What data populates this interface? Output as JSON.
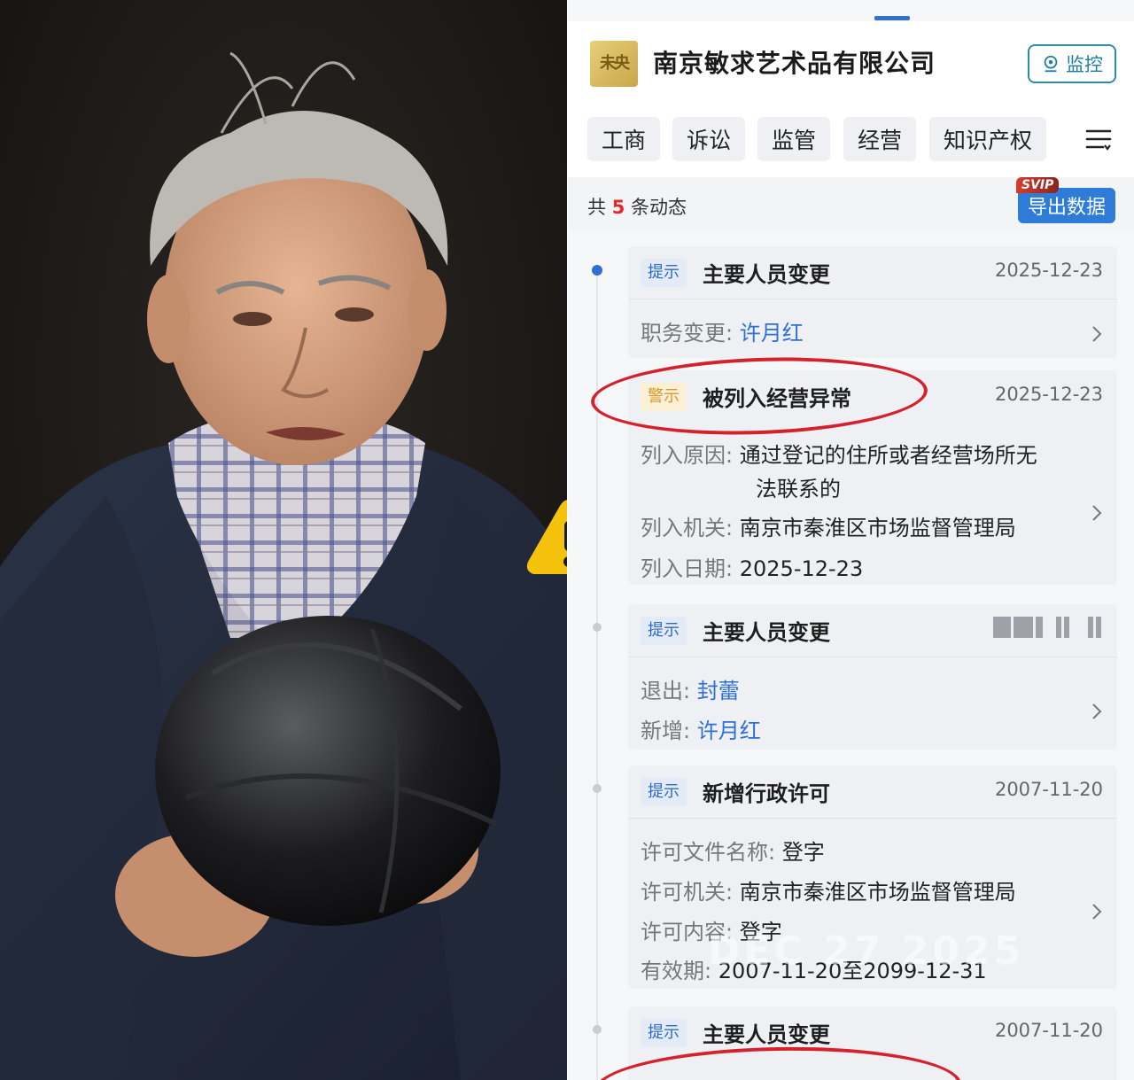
{
  "company": {
    "logo_text": "未央",
    "name": "南京敏求艺术品有限公司",
    "monitor_label": "监控"
  },
  "tabs": [
    "工商",
    "诉讼",
    "监管",
    "经营",
    "知识产权"
  ],
  "summary": {
    "prefix": "共",
    "count": "5",
    "suffix": "条动态",
    "svip_label": "SVIP",
    "export_label": "导出数据"
  },
  "events": [
    {
      "tag": "提示",
      "title": "主要人员变更",
      "date": "2025-12-23",
      "rows": [
        {
          "key": "职务变更:",
          "value": "许月红"
        }
      ]
    },
    {
      "tag": "警示",
      "title": "被列入经营异常",
      "date": "2025-12-23",
      "rows": [
        {
          "key": "列入原因:",
          "value": "通过登记的住所或者经营场所无",
          "value2": "法联系的"
        },
        {
          "key": "列入机关:",
          "value": "南京市秦淮区市场监督管理局"
        },
        {
          "key": "列入日期:",
          "value": "2025-12-23"
        }
      ]
    },
    {
      "tag": "提示",
      "title": "主要人员变更",
      "date": "",
      "rows": [
        {
          "key": "退出:",
          "value": "封蕾"
        },
        {
          "key": "新增:",
          "value": "许月红"
        }
      ]
    },
    {
      "tag": "提示",
      "title": "新增行政许可",
      "date": "2007-11-20",
      "rows": [
        {
          "key": "许可文件名称:",
          "value": "登字"
        },
        {
          "key": "许可机关:",
          "value": "南京市秦淮区市场监督管理局"
        },
        {
          "key": "许可内容:",
          "value": "登字"
        },
        {
          "key": "有效期:",
          "value": "2007-11-20至2099-12-31"
        }
      ]
    },
    {
      "tag": "提示",
      "title": "主要人员变更",
      "date": "2007-11-20"
    }
  ],
  "watermark": "DEC 27 2025",
  "colors": {
    "accent_blue": "#2f6fd6",
    "warn_red": "#d4222d",
    "warning_yellow": "#f4c20d"
  }
}
